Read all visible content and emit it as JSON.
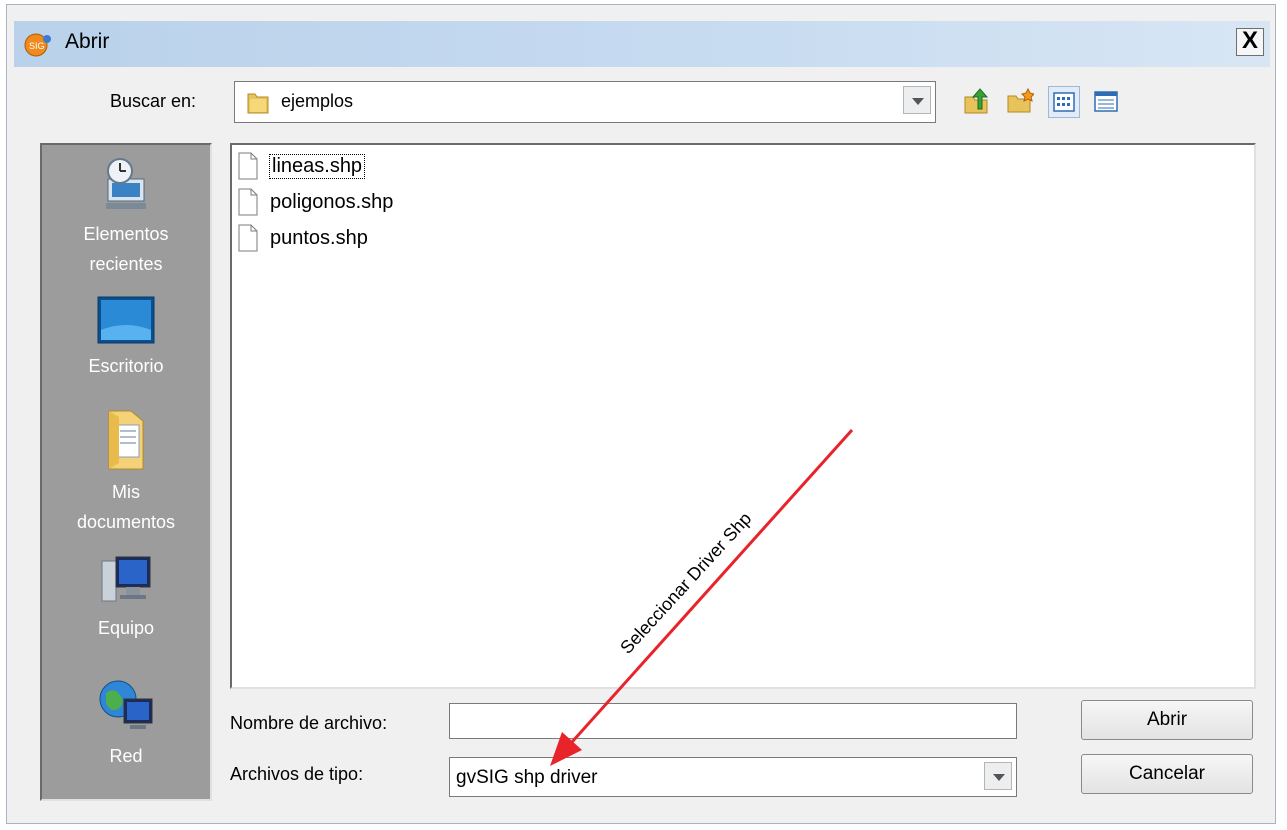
{
  "window": {
    "title": "Abrir",
    "close_label": "X"
  },
  "toolbar": {
    "look_in_label": "Buscar en:",
    "look_in_value": "ejemplos",
    "icons": [
      "up-folder-icon",
      "new-folder-icon",
      "list-view-icon",
      "details-view-icon"
    ]
  },
  "places": [
    {
      "line1": "Elementos",
      "line2": "recientes",
      "icon": "recent-items-icon"
    },
    {
      "line1": "Escritorio",
      "line2": "",
      "icon": "desktop-icon"
    },
    {
      "line1": "Mis",
      "line2": "documentos",
      "icon": "documents-icon"
    },
    {
      "line1": "Equipo",
      "line2": "",
      "icon": "computer-icon"
    },
    {
      "line1": "Red",
      "line2": "",
      "icon": "network-icon"
    }
  ],
  "files": [
    {
      "name": "lineas.shp",
      "selected": true
    },
    {
      "name": "poligonos.shp",
      "selected": false
    },
    {
      "name": "puntos.shp",
      "selected": false
    }
  ],
  "form": {
    "filename_label": "Nombre de archivo:",
    "filename_value": "",
    "filetype_label": "Archivos de tipo:",
    "filetype_value": "gvSIG shp driver"
  },
  "buttons": {
    "open": "Abrir",
    "cancel": "Cancelar"
  },
  "annotation": {
    "text": "Seleccionar Driver Shp",
    "color": "#e8232a"
  }
}
